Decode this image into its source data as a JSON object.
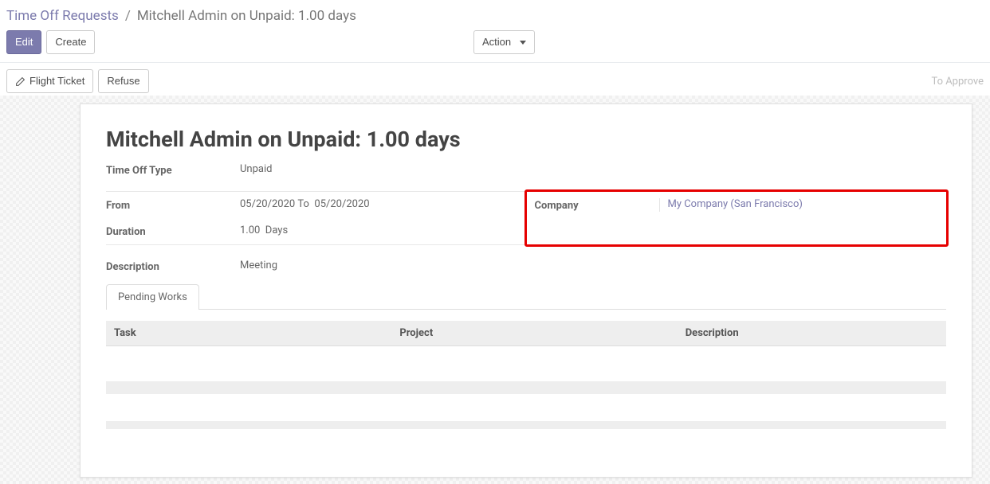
{
  "breadcrumb": {
    "root": "Time Off Requests",
    "current": "Mitchell Admin on Unpaid: 1.00 days"
  },
  "toolbar": {
    "edit_label": "Edit",
    "create_label": "Create",
    "action_label": "Action"
  },
  "statusbar": {
    "flight_ticket_label": "Flight Ticket",
    "refuse_label": "Refuse",
    "status_right": "To Approve"
  },
  "form": {
    "title": "Mitchell Admin on Unpaid: 1.00 days",
    "time_off_type_label": "Time Off Type",
    "time_off_type_value": "Unpaid",
    "from_label": "From",
    "from_value": "05/20/2020 To  05/20/2020",
    "duration_label": "Duration",
    "duration_value": "1.00  Days",
    "company_label": "Company",
    "company_value": "My Company (San Francisco)",
    "description_label": "Description",
    "description_value": "Meeting"
  },
  "tabs": {
    "pending_works": "Pending Works"
  },
  "table": {
    "columns": {
      "task": "Task",
      "project": "Project",
      "description": "Description"
    }
  },
  "icons": {
    "pencil": "pencil-icon"
  }
}
